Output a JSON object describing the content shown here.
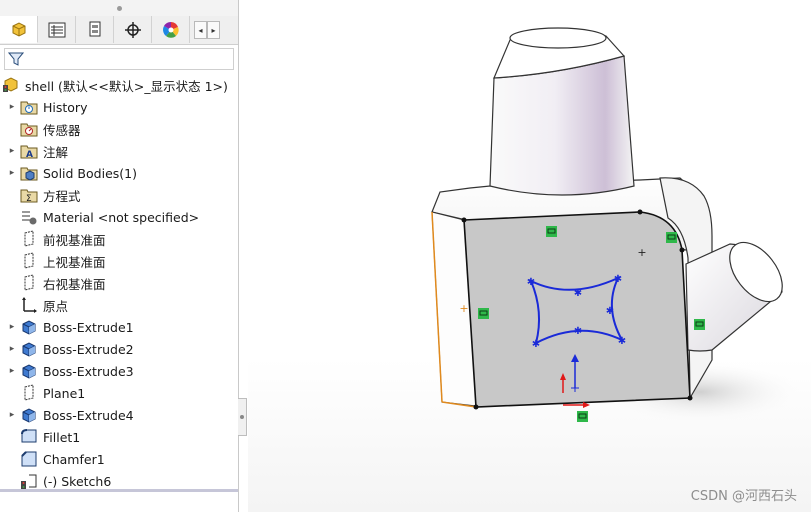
{
  "tabs": [
    {
      "name": "feature-manager",
      "icon": "feature-tree-icon"
    },
    {
      "name": "property-manager",
      "icon": "property-list-icon"
    },
    {
      "name": "configuration-manager",
      "icon": "configuration-icon"
    },
    {
      "name": "dimxpert-manager",
      "icon": "crosshair-icon"
    },
    {
      "name": "display-manager",
      "icon": "color-wheel-icon"
    },
    {
      "name": "more-tabs",
      "icon": "more-tab-icon"
    }
  ],
  "tree": {
    "root_label": "shell  (默认<<默认>_显示状态 1>)",
    "items": [
      {
        "label": "History",
        "icon": "history-folder-icon",
        "expandable": true
      },
      {
        "label": "传感器",
        "icon": "sensor-folder-icon",
        "expandable": false
      },
      {
        "label": "注解",
        "icon": "annotation-folder-icon",
        "expandable": true
      },
      {
        "label": "Solid Bodies(1)",
        "icon": "solid-bodies-folder-icon",
        "expandable": true
      },
      {
        "label": "方程式",
        "icon": "equations-folder-icon",
        "expandable": false
      },
      {
        "label": "Material <not specified>",
        "icon": "material-icon",
        "expandable": false
      },
      {
        "label": "前视基准面",
        "icon": "plane-icon",
        "expandable": false
      },
      {
        "label": "上视基准面",
        "icon": "plane-icon",
        "expandable": false
      },
      {
        "label": "右视基准面",
        "icon": "plane-icon",
        "expandable": false
      },
      {
        "label": "原点",
        "icon": "origin-icon",
        "expandable": false
      },
      {
        "label": "Boss-Extrude1",
        "icon": "extrude-icon",
        "expandable": true
      },
      {
        "label": "Boss-Extrude2",
        "icon": "extrude-icon",
        "expandable": true
      },
      {
        "label": "Boss-Extrude3",
        "icon": "extrude-icon",
        "expandable": true
      },
      {
        "label": "Plane1",
        "icon": "plane-icon",
        "expandable": false
      },
      {
        "label": "Boss-Extrude4",
        "icon": "extrude-icon",
        "expandable": true
      },
      {
        "label": "Fillet1",
        "icon": "fillet-icon",
        "expandable": false
      },
      {
        "label": "Chamfer1",
        "icon": "chamfer-icon",
        "expandable": false
      },
      {
        "label": "(-) Sketch6",
        "icon": "sketch-icon",
        "expandable": false
      }
    ]
  },
  "watermark": "CSDN @河西石头",
  "colors": {
    "sketch_curve": "#1a2ad8",
    "selected_face": "#c8c8c8",
    "relation_marker": "#2fb84a",
    "origin_red": "#e01818",
    "origin_blue": "#1a2ad8",
    "highlight_edge": "#e08a1e"
  }
}
